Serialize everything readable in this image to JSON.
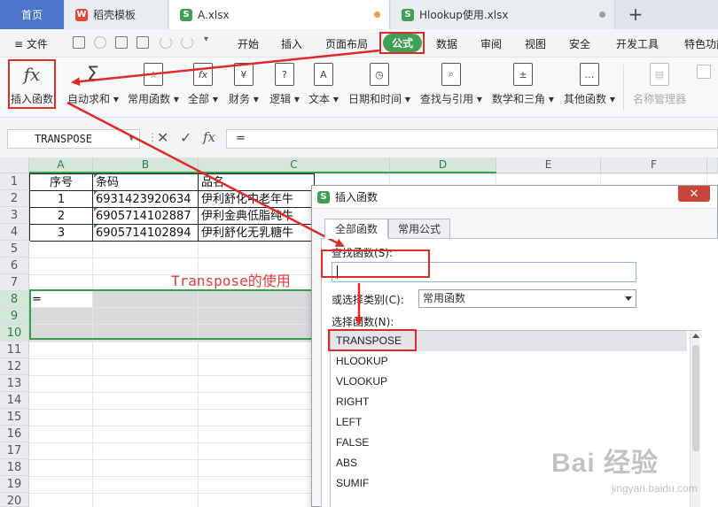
{
  "tabs": {
    "home": "首页",
    "items": [
      {
        "label": "稻壳模板",
        "logo": "W",
        "color": "#e0483a"
      },
      {
        "label": "A.xlsx",
        "logo": "S",
        "color": "#3f9f55"
      },
      {
        "label": "Hlookup使用.xlsx",
        "logo": "S",
        "color": "#3f9f55"
      }
    ],
    "new_tab": "+"
  },
  "menu": {
    "file": "文件",
    "items": [
      "开始",
      "插入",
      "页面布局",
      "公式",
      "数据",
      "审阅",
      "视图",
      "安全",
      "开发工具",
      "特色功能"
    ],
    "active_index": 3
  },
  "ribbon": {
    "buttons": [
      {
        "label": "插入函数",
        "icon": "fx-icon",
        "glyph": "fx"
      },
      {
        "label": "自动求和",
        "icon": "sigma-icon",
        "glyph": "Σ"
      },
      {
        "label": "常用函数",
        "icon": "star-function-icon",
        "glyph": "☆"
      },
      {
        "label": "全部",
        "icon": "fx-all-icon",
        "glyph": "fx"
      },
      {
        "label": "财务",
        "icon": "yen-icon",
        "glyph": "¥"
      },
      {
        "label": "逻辑",
        "icon": "question-icon",
        "glyph": "?"
      },
      {
        "label": "文本",
        "icon": "text-a-icon",
        "glyph": "A"
      },
      {
        "label": "日期和时间",
        "icon": "clock-icon",
        "glyph": "◷"
      },
      {
        "label": "查找与引用",
        "icon": "magnifier-icon",
        "glyph": "⌕"
      },
      {
        "label": "数学和三角",
        "icon": "math-icon",
        "glyph": "±"
      },
      {
        "label": "其他函数",
        "icon": "more-functions-icon",
        "glyph": "…"
      },
      {
        "label": "名称管理器",
        "icon": "name-manager-icon",
        "glyph": "▤"
      }
    ]
  },
  "formula_bar": {
    "name_box": "TRANSPOSE",
    "cancel_glyph": "✕",
    "confirm_glyph": "✓",
    "fx_glyph": "fx",
    "formula": "="
  },
  "sheet": {
    "columns": [
      "A",
      "B",
      "C",
      "D",
      "E",
      "F"
    ],
    "rows": [
      "1",
      "2",
      "3",
      "4",
      "5",
      "6",
      "7",
      "8",
      "9",
      "10",
      "11",
      "12",
      "13",
      "14",
      "15",
      "16",
      "17",
      "18",
      "19",
      "20"
    ],
    "header_row": {
      "seq": "序号",
      "code": "条码",
      "name": "品名"
    },
    "data": [
      {
        "seq": "1",
        "code": "6931423920634",
        "name": "伊利舒化中老年牛"
      },
      {
        "seq": "2",
        "code": "6905714102887",
        "name": "伊利金典低脂纯牛"
      },
      {
        "seq": "3",
        "code": "6905714102894",
        "name": "伊利舒化无乳糖牛"
      }
    ],
    "active_cell_value": "=",
    "annotation": "Transpose的使用"
  },
  "dialog": {
    "title": "插入函数",
    "close": "✕",
    "tabs": [
      "全部函数",
      "常用公式"
    ],
    "search_label": "查找函数(S):",
    "search_value": "",
    "category_label": "或选择类别(C):",
    "category_value": "常用函数",
    "select_label": "选择函数(N):",
    "functions": [
      "TRANSPOSE",
      "HLOOKUP",
      "VLOOKUP",
      "RIGHT",
      "LEFT",
      "FALSE",
      "ABS",
      "SUMIF"
    ],
    "selected_index": 0
  },
  "watermark": {
    "main": "Bai 经验",
    "sub": "jingyan.baidu.com"
  },
  "colors": {
    "accent": "#3f9f55",
    "annotation": "#e02a2a",
    "home_tab": "#4a73c9"
  }
}
